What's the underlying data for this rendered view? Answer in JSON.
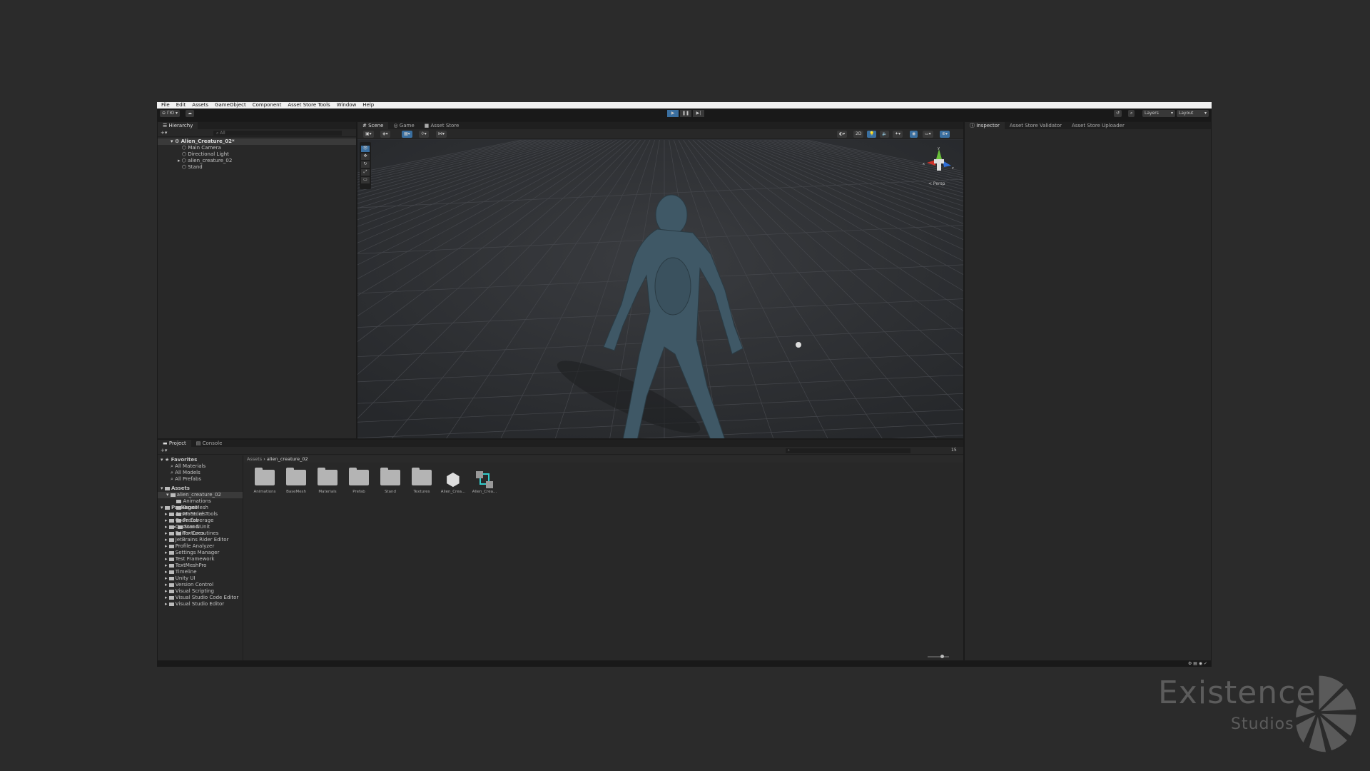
{
  "menu": [
    "File",
    "Edit",
    "Assets",
    "GameObject",
    "Component",
    "Asset Store Tools",
    "Window",
    "Help"
  ],
  "toolbar": {
    "account": "ГЮ",
    "layers": "Layers",
    "layout": "Layout",
    "play": "▶",
    "pause": "❚❚",
    "step": "▶|"
  },
  "hierarchy": {
    "tab": "Hierarchy",
    "search_placeholder": "All",
    "scene": "Alien_Creature_02*",
    "items": [
      "Main Camera",
      "Directional Light",
      "alien_creature_02",
      "Stand"
    ]
  },
  "scene": {
    "tabs": [
      "Scene",
      "Game",
      "Asset Store"
    ],
    "persp": "< Persp",
    "axes": {
      "x": "x",
      "y": "y",
      "z": "z"
    }
  },
  "inspector": {
    "tabs": [
      "Inspector",
      "Asset Store Validator",
      "Asset Store Uploader"
    ]
  },
  "project": {
    "tabs": [
      "Project",
      "Console"
    ],
    "favorites": {
      "label": "Favorites",
      "items": [
        "All Materials",
        "All Models",
        "All Prefabs"
      ]
    },
    "assets": {
      "label": "Assets",
      "root": "alien_creature_02",
      "children": [
        "Animations",
        "BaseMesh",
        "Materials",
        "Prefab",
        "Stand",
        "Textures"
      ]
    },
    "packages": {
      "label": "Packages",
      "items": [
        "Asset Store Tools",
        "Code Coverage",
        "Custom NUnit",
        "Editor Coroutines",
        "JetBrains Rider Editor",
        "Profile Analyzer",
        "Settings Manager",
        "Test Framework",
        "TextMeshPro",
        "Timeline",
        "Unity UI",
        "Version Control",
        "Visual Scripting",
        "Visual Studio Code Editor",
        "Visual Studio Editor"
      ]
    },
    "breadcrumb": [
      "Assets",
      "alien_creature_02"
    ],
    "grid": [
      "Animations",
      "BaseMesh",
      "Materials",
      "Prefab",
      "Stand",
      "Textures",
      "Alien_Crea...",
      "Alien_Crea..."
    ],
    "hidden_count": "15"
  },
  "watermark": {
    "line1": "Existence",
    "line2": "Studios"
  },
  "colors": {
    "accent": "#3a6fa0",
    "menubar": "#f0f0f0",
    "panel": "#282828"
  }
}
